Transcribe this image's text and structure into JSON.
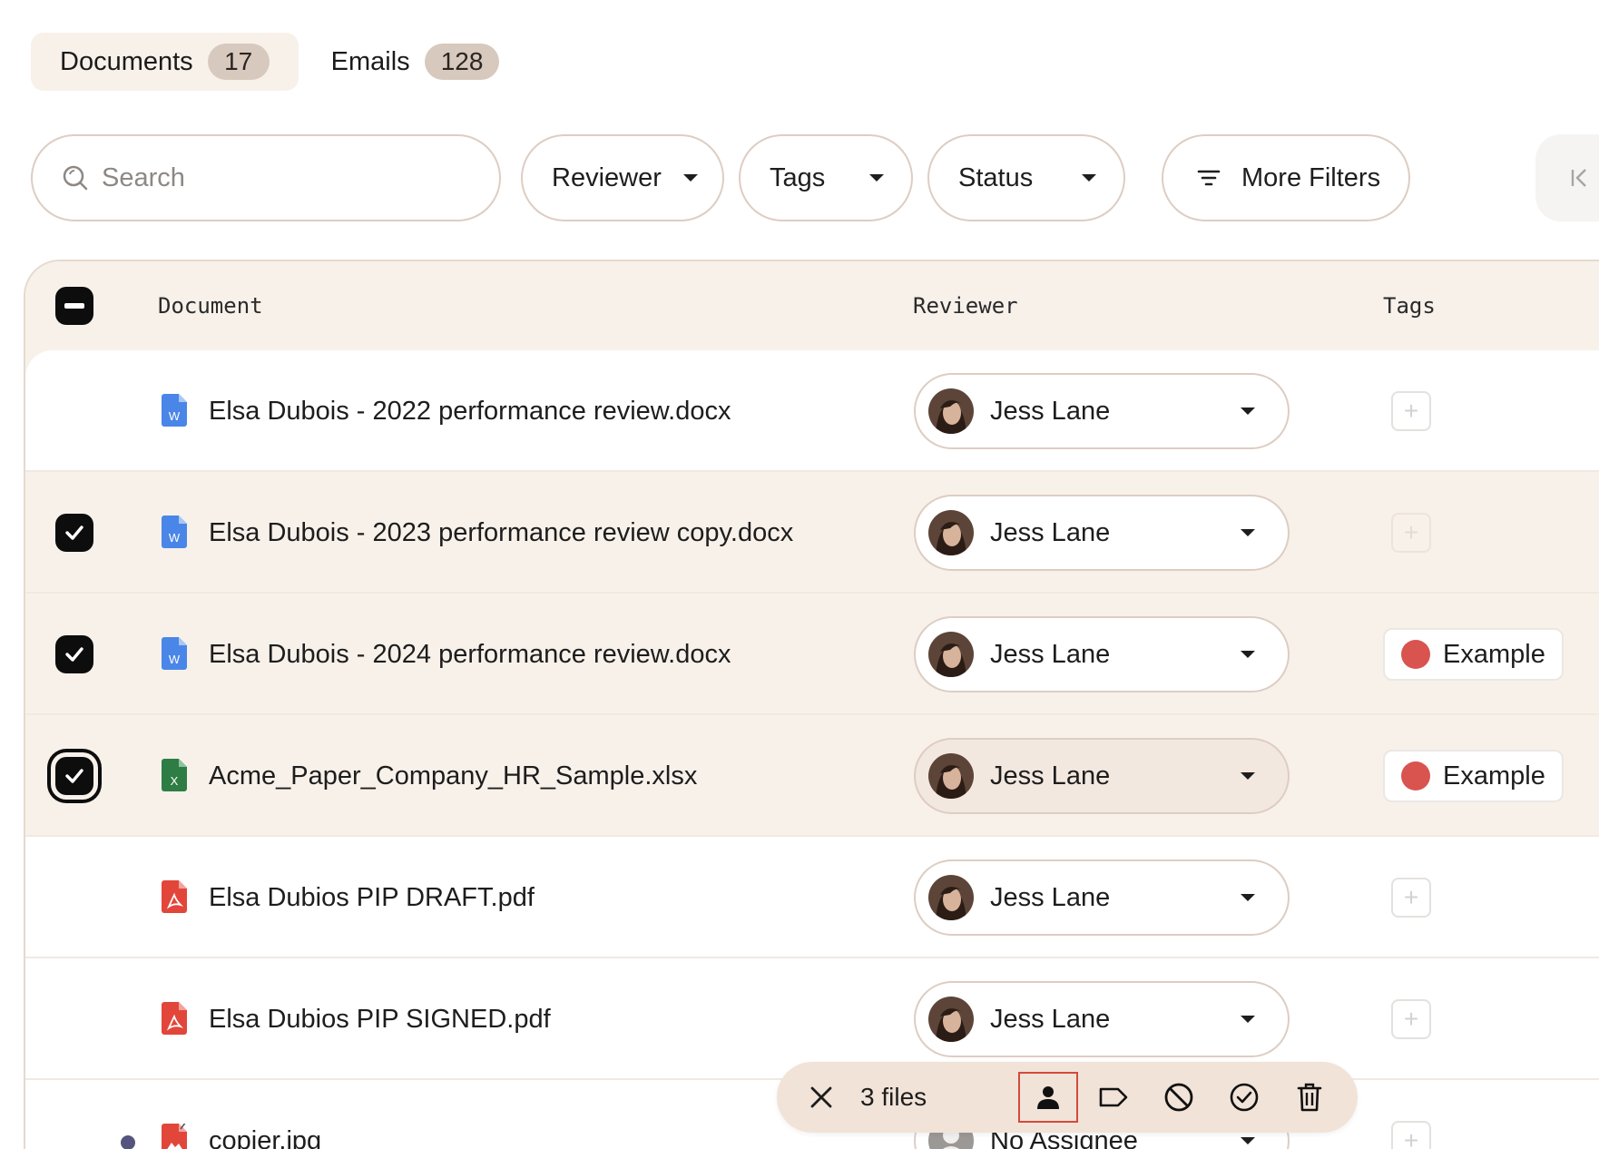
{
  "tabs": [
    {
      "label": "Documents",
      "count": "17",
      "active": true
    },
    {
      "label": "Emails",
      "count": "128",
      "active": false
    }
  ],
  "filters": {
    "search_placeholder": "Search",
    "reviewer_label": "Reviewer",
    "tags_label": "Tags",
    "status_label": "Status",
    "more_filters_label": "More Filters"
  },
  "table": {
    "headers": {
      "document": "Document",
      "reviewer": "Reviewer",
      "tags": "Tags"
    },
    "rows": [
      {
        "name": "Elsa Dubois - 2022 performance review.docx",
        "type": "docx",
        "selected": false,
        "reviewer": "Jess Lane",
        "tag": null
      },
      {
        "name": "Elsa Dubois - 2023 performance review copy.docx",
        "type": "docx",
        "selected": true,
        "reviewer": "Jess Lane",
        "tag": null
      },
      {
        "name": "Elsa Dubois - 2024 performance review.docx",
        "type": "docx",
        "selected": true,
        "reviewer": "Jess Lane",
        "tag": "Example"
      },
      {
        "name": "Acme_Paper_Company_HR_Sample.xlsx",
        "type": "xlsx",
        "selected": true,
        "reviewer": "Jess Lane",
        "tag": "Example"
      },
      {
        "name": "Elsa Dubios PIP DRAFT.pdf",
        "type": "pdf",
        "selected": false,
        "reviewer": "Jess Lane",
        "tag": null
      },
      {
        "name": "Elsa Dubios PIP SIGNED.pdf",
        "type": "pdf",
        "selected": false,
        "reviewer": "Jess Lane",
        "tag": null
      },
      {
        "name": "copier.jpg",
        "type": "image",
        "selected": false,
        "reviewer": "No Assignee",
        "tag": null
      }
    ]
  },
  "action_bar": {
    "selection_count": "3 files",
    "actions": [
      "assign-reviewer",
      "add-tag",
      "exclude",
      "mark-complete",
      "delete"
    ]
  },
  "colors": {
    "accent_bg": "#f8f1ea",
    "badge_bg": "#d7c9bd",
    "tag_red": "#d9544f",
    "docx_blue": "#4a86e8",
    "xlsx_green": "#2e7d45",
    "pdf_red": "#e2463a",
    "highlight_outline": "#d34a3c"
  }
}
